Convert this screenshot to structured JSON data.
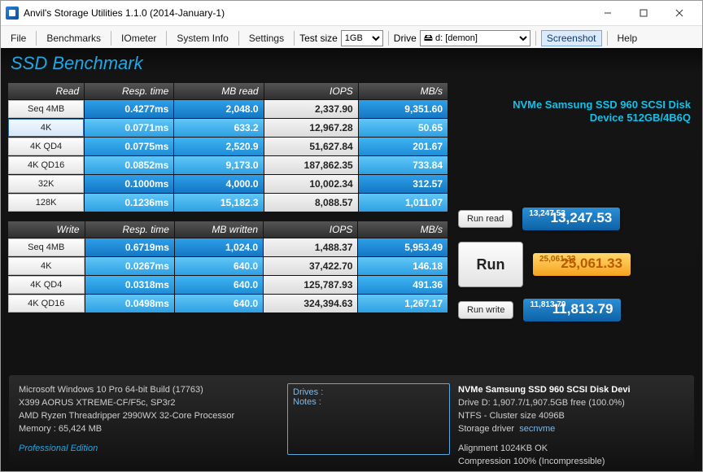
{
  "window": {
    "title": "Anvil's Storage Utilities 1.1.0 (2014-January-1)"
  },
  "menu": {
    "file": "File",
    "benchmarks": "Benchmarks",
    "iometer": "IOmeter",
    "systeminfo": "System Info",
    "settings": "Settings",
    "testsize_label": "Test size",
    "testsize_value": "1GB",
    "drive_label": "Drive",
    "drive_value": "🖴 d: [demon]",
    "screenshot": "Screenshot",
    "help": "Help"
  },
  "heading": "SSD Benchmark",
  "device_line1": "NVMe Samsung SSD 960 SCSI Disk",
  "device_line2": "Device 512GB/4B6Q",
  "cols": {
    "read": "Read",
    "resp": "Resp. time",
    "mbread": "MB read",
    "iops": "IOPS",
    "mbs": "MB/s",
    "write": "Write",
    "mbwritten": "MB written"
  },
  "read_rows": [
    {
      "label": "Seq 4MB",
      "resp": "0.4277ms",
      "mb": "2,048.0",
      "iops": "2,337.90",
      "mbs": "9,351.60"
    },
    {
      "label": "4K",
      "resp": "0.0771ms",
      "mb": "633.2",
      "iops": "12,967.28",
      "mbs": "50.65",
      "selected": true
    },
    {
      "label": "4K QD4",
      "resp": "0.0775ms",
      "mb": "2,520.9",
      "iops": "51,627.84",
      "mbs": "201.67"
    },
    {
      "label": "4K QD16",
      "resp": "0.0852ms",
      "mb": "9,173.0",
      "iops": "187,862.35",
      "mbs": "733.84"
    },
    {
      "label": "32K",
      "resp": "0.1000ms",
      "mb": "4,000.0",
      "iops": "10,002.34",
      "mbs": "312.57"
    },
    {
      "label": "128K",
      "resp": "0.1236ms",
      "mb": "15,182.3",
      "iops": "8,088.57",
      "mbs": "1,011.07"
    }
  ],
  "write_rows": [
    {
      "label": "Seq 4MB",
      "resp": "0.6719ms",
      "mb": "1,024.0",
      "iops": "1,488.37",
      "mbs": "5,953.49"
    },
    {
      "label": "4K",
      "resp": "0.0267ms",
      "mb": "640.0",
      "iops": "37,422.70",
      "mbs": "146.18"
    },
    {
      "label": "4K QD4",
      "resp": "0.0318ms",
      "mb": "640.0",
      "iops": "125,787.93",
      "mbs": "491.36"
    },
    {
      "label": "4K QD16",
      "resp": "0.0498ms",
      "mb": "640.0",
      "iops": "324,394.63",
      "mbs": "1,267.17"
    }
  ],
  "buttons": {
    "runread": "Run read",
    "run": "Run",
    "runwrite": "Run write"
  },
  "scores": {
    "read": {
      "mini": "13,247.53",
      "big": "13,247.53"
    },
    "total": {
      "mini": "25,061.33",
      "big": "25,061.33"
    },
    "write": {
      "mini": "11,813.79",
      "big": "11,813.79"
    }
  },
  "footer": {
    "os": "Microsoft Windows 10 Pro 64-bit Build (17763)",
    "mb": "X399 AORUS XTREME-CF/F5c, SP3r2",
    "cpu": "AMD Ryzen Threadripper 2990WX 32-Core Processor",
    "mem": "Memory : 65,424 MB",
    "edition": "Professional Edition",
    "drives_label": "Drives :",
    "notes_label": "Notes :",
    "disk_name": "NVMe Samsung SSD 960 SCSI Disk Devi",
    "disk_cap": "Drive D: 1,907.7/1,907.5GB free (100.0%)",
    "disk_fs": "NTFS - Cluster size 4096B",
    "disk_drv_l": "Storage driver",
    "disk_drv_v": "secnvme",
    "align": "Alignment 1024KB OK",
    "comp": "Compression 100% (Incompressible)"
  }
}
